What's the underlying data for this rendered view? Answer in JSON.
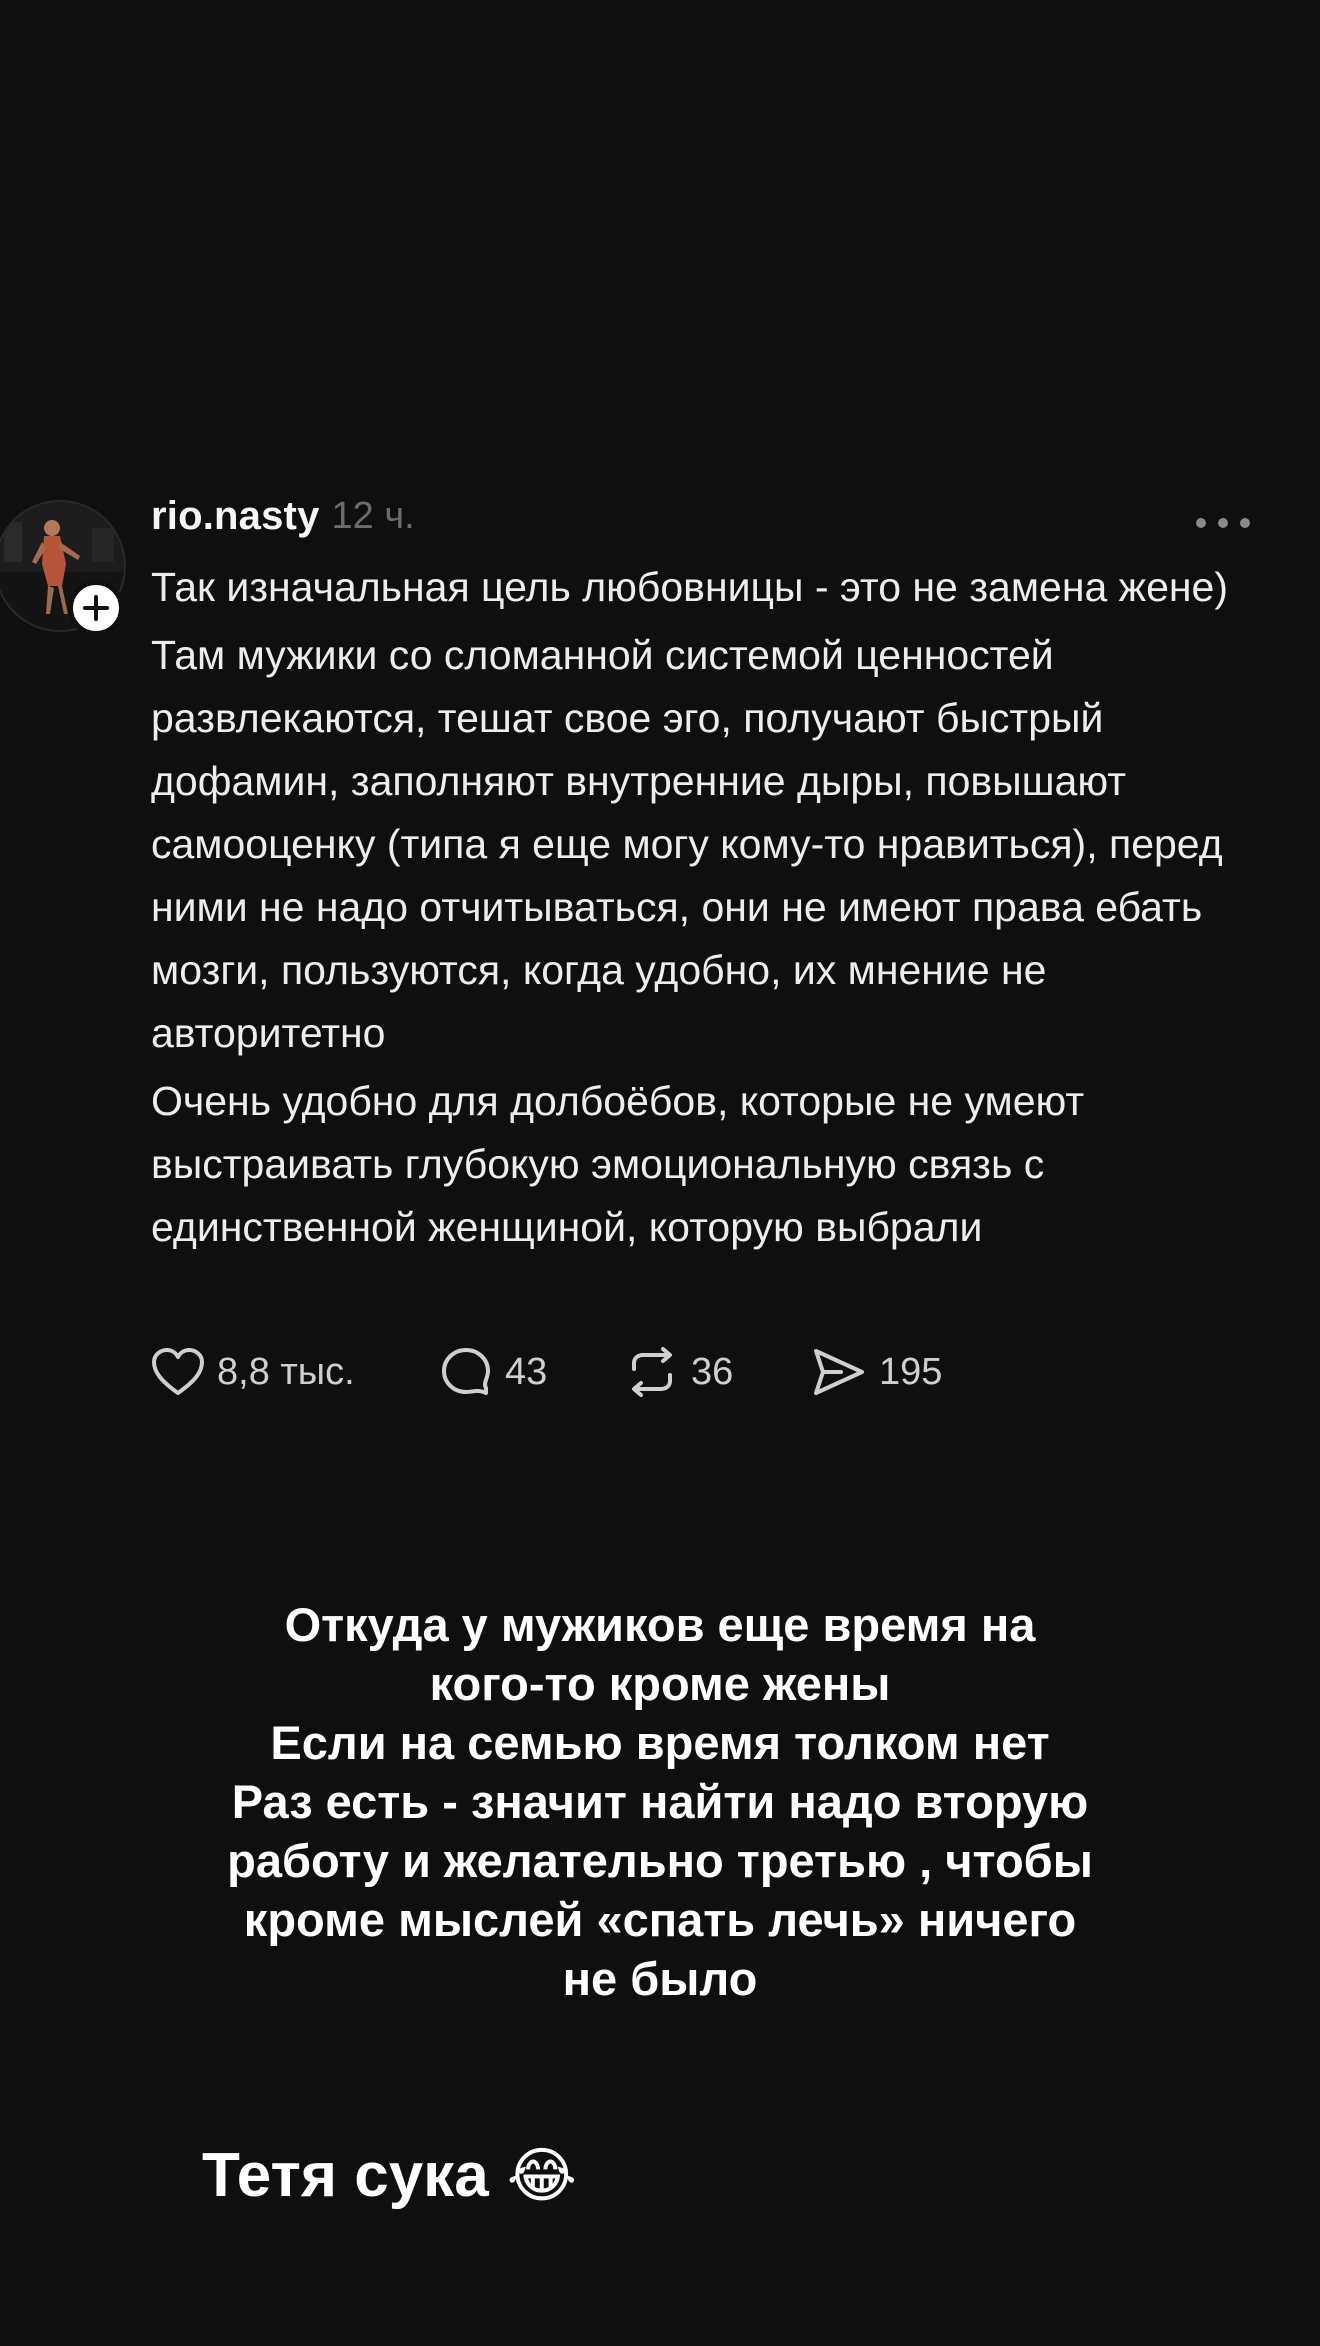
{
  "post": {
    "username": "rio.nasty",
    "time": "12 ч.",
    "paragraphs": [
      "Так изначальная цель любовницы - это не замена жене)",
      "Там мужики со сломанной системой ценностей развлекаются, тешат свое эго, получают быстрый дофамин, заполняют внутренние дыры, повышают самооценку (типа я еще могу кому-то нравиться), перед ними не надо отчитываться, они не имеют права ебать мозги, пользуются, когда удобно, их мнение не авторитетно",
      "Очень удобно для долбоёбов, которые не умеют выстраивать глубокую эмоциональную связь с единственной женщиной, которую выбрали"
    ],
    "actions": {
      "likes": "8,8 тыс.",
      "replies": "43",
      "reposts": "36",
      "shares": "195"
    }
  },
  "caption": {
    "lines": [
      "Откуда у мужиков еще время на",
      "кого-то кроме жены",
      "Если на семью время толком нет",
      "Раз есть - значит найти надо вторую",
      "работу и желательно третью , чтобы",
      "кроме мыслей «спать лечь» ничего",
      "не было"
    ]
  },
  "reaction": {
    "text": "Тетя сука",
    "emoji": "😂"
  },
  "icons": {
    "avatar": "avatar-photo",
    "follow": "plus-icon",
    "more": "more-dots-icon",
    "like": "heart-icon",
    "reply": "comment-bubble-icon",
    "repost": "repost-icon",
    "share": "send-icon"
  }
}
